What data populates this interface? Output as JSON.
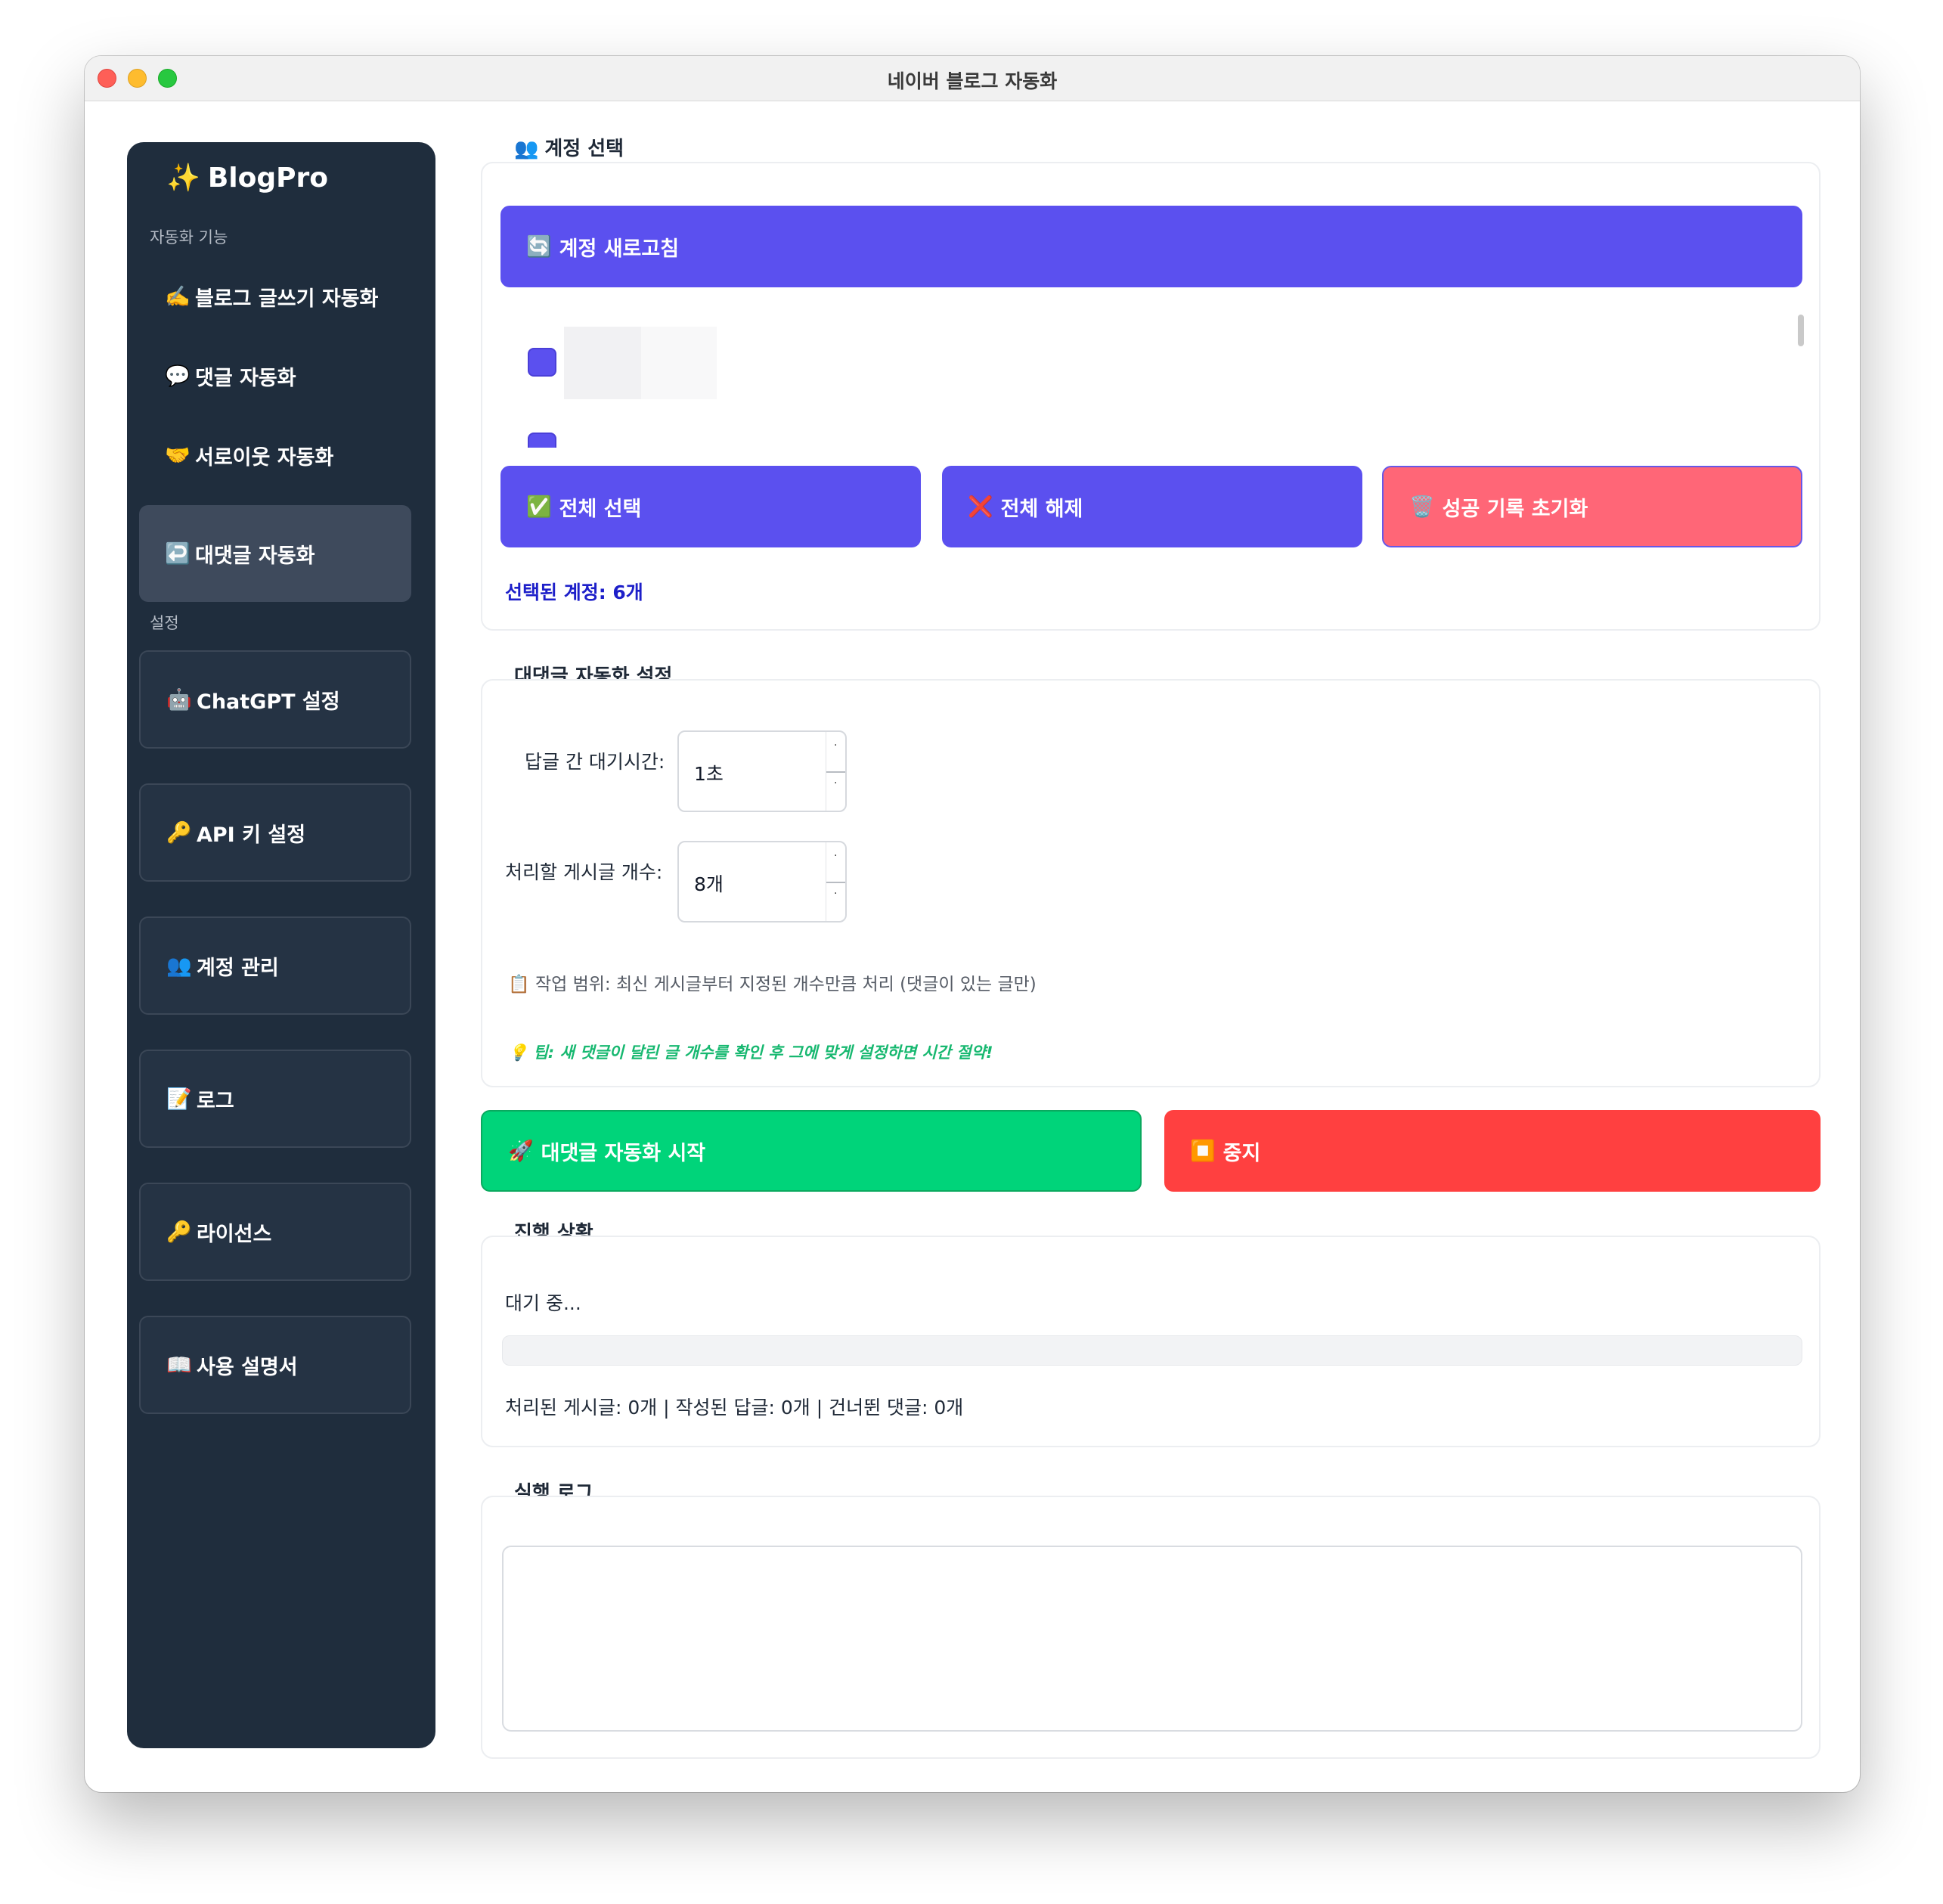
{
  "window": {
    "title": "네이버 블로그 자동화"
  },
  "sidebar": {
    "brand": {
      "icon": "✨",
      "name": "BlogPro"
    },
    "section_automation": "자동화 기능",
    "automation_items": [
      {
        "icon": "✍️",
        "label": "블로그 글쓰기 자동화"
      },
      {
        "icon": "💬",
        "label": "댓글 자동화"
      },
      {
        "icon": "🤝",
        "label": "서로이웃 자동화"
      },
      {
        "icon": "↩️",
        "label": "대댓글 자동화"
      }
    ],
    "section_settings": "설정",
    "settings_items": [
      {
        "icon": "🤖",
        "label": "ChatGPT 설정"
      },
      {
        "icon": "🔑",
        "label": "API 키 설정"
      },
      {
        "icon": "👥",
        "label": "계정 관리"
      },
      {
        "icon": "📝",
        "label": "로그"
      },
      {
        "icon": "🔑",
        "label": "라이선스"
      },
      {
        "icon": "📖",
        "label": "사용 설명서"
      }
    ]
  },
  "account_section": {
    "icon": "👥",
    "title": "계정 선택",
    "refresh_button": {
      "icon": "🔄",
      "label": "계정 새로고침"
    },
    "select_all": {
      "icon": "✅",
      "label": "전체 선택"
    },
    "deselect_all": {
      "icon": "❌",
      "label": "전체 해제"
    },
    "reset_success": {
      "icon": "🗑️",
      "label": "성공 기록 초기화"
    },
    "selected_count": "선택된 계정: 6개"
  },
  "reply_settings": {
    "title": "대댓글 자동화 설정",
    "wait_label": "답글 간 대기시간:",
    "wait_value": "1초",
    "posts_label": "처리할 게시글 개수:",
    "posts_value": "8개",
    "scope_icon": "📋",
    "scope_text": "작업 범위: 최신 게시글부터 지정된 개수만큼 처리 (댓글이 있는 글만)",
    "tip_icon": "💡",
    "tip_text": "팁: 새 댓글이 달린 글 개수를 확인 후 그에 맞게 설정하면 시간 절약!"
  },
  "actions": {
    "start": {
      "icon": "🚀",
      "label": "대댓글 자동화 시작"
    },
    "stop": {
      "icon": "⏹️",
      "label": "중지"
    }
  },
  "progress_section": {
    "title": "진행 상황",
    "status": "대기 중...",
    "progress_fraction": 0,
    "stats": "처리된 게시글: 0개 | 작성된 답글: 0개 | 건너뛴 댓글: 0개"
  },
  "log_section": {
    "title": "실행 로그",
    "content": ""
  },
  "colors": {
    "sidebar_bg": "#1f2d3d",
    "accent": "#5b50ef",
    "start": "#00d47a",
    "stop": "#ff4040",
    "reset": "#ff6677",
    "selected_count": "#1d1fc9",
    "tip": "#17b870"
  }
}
